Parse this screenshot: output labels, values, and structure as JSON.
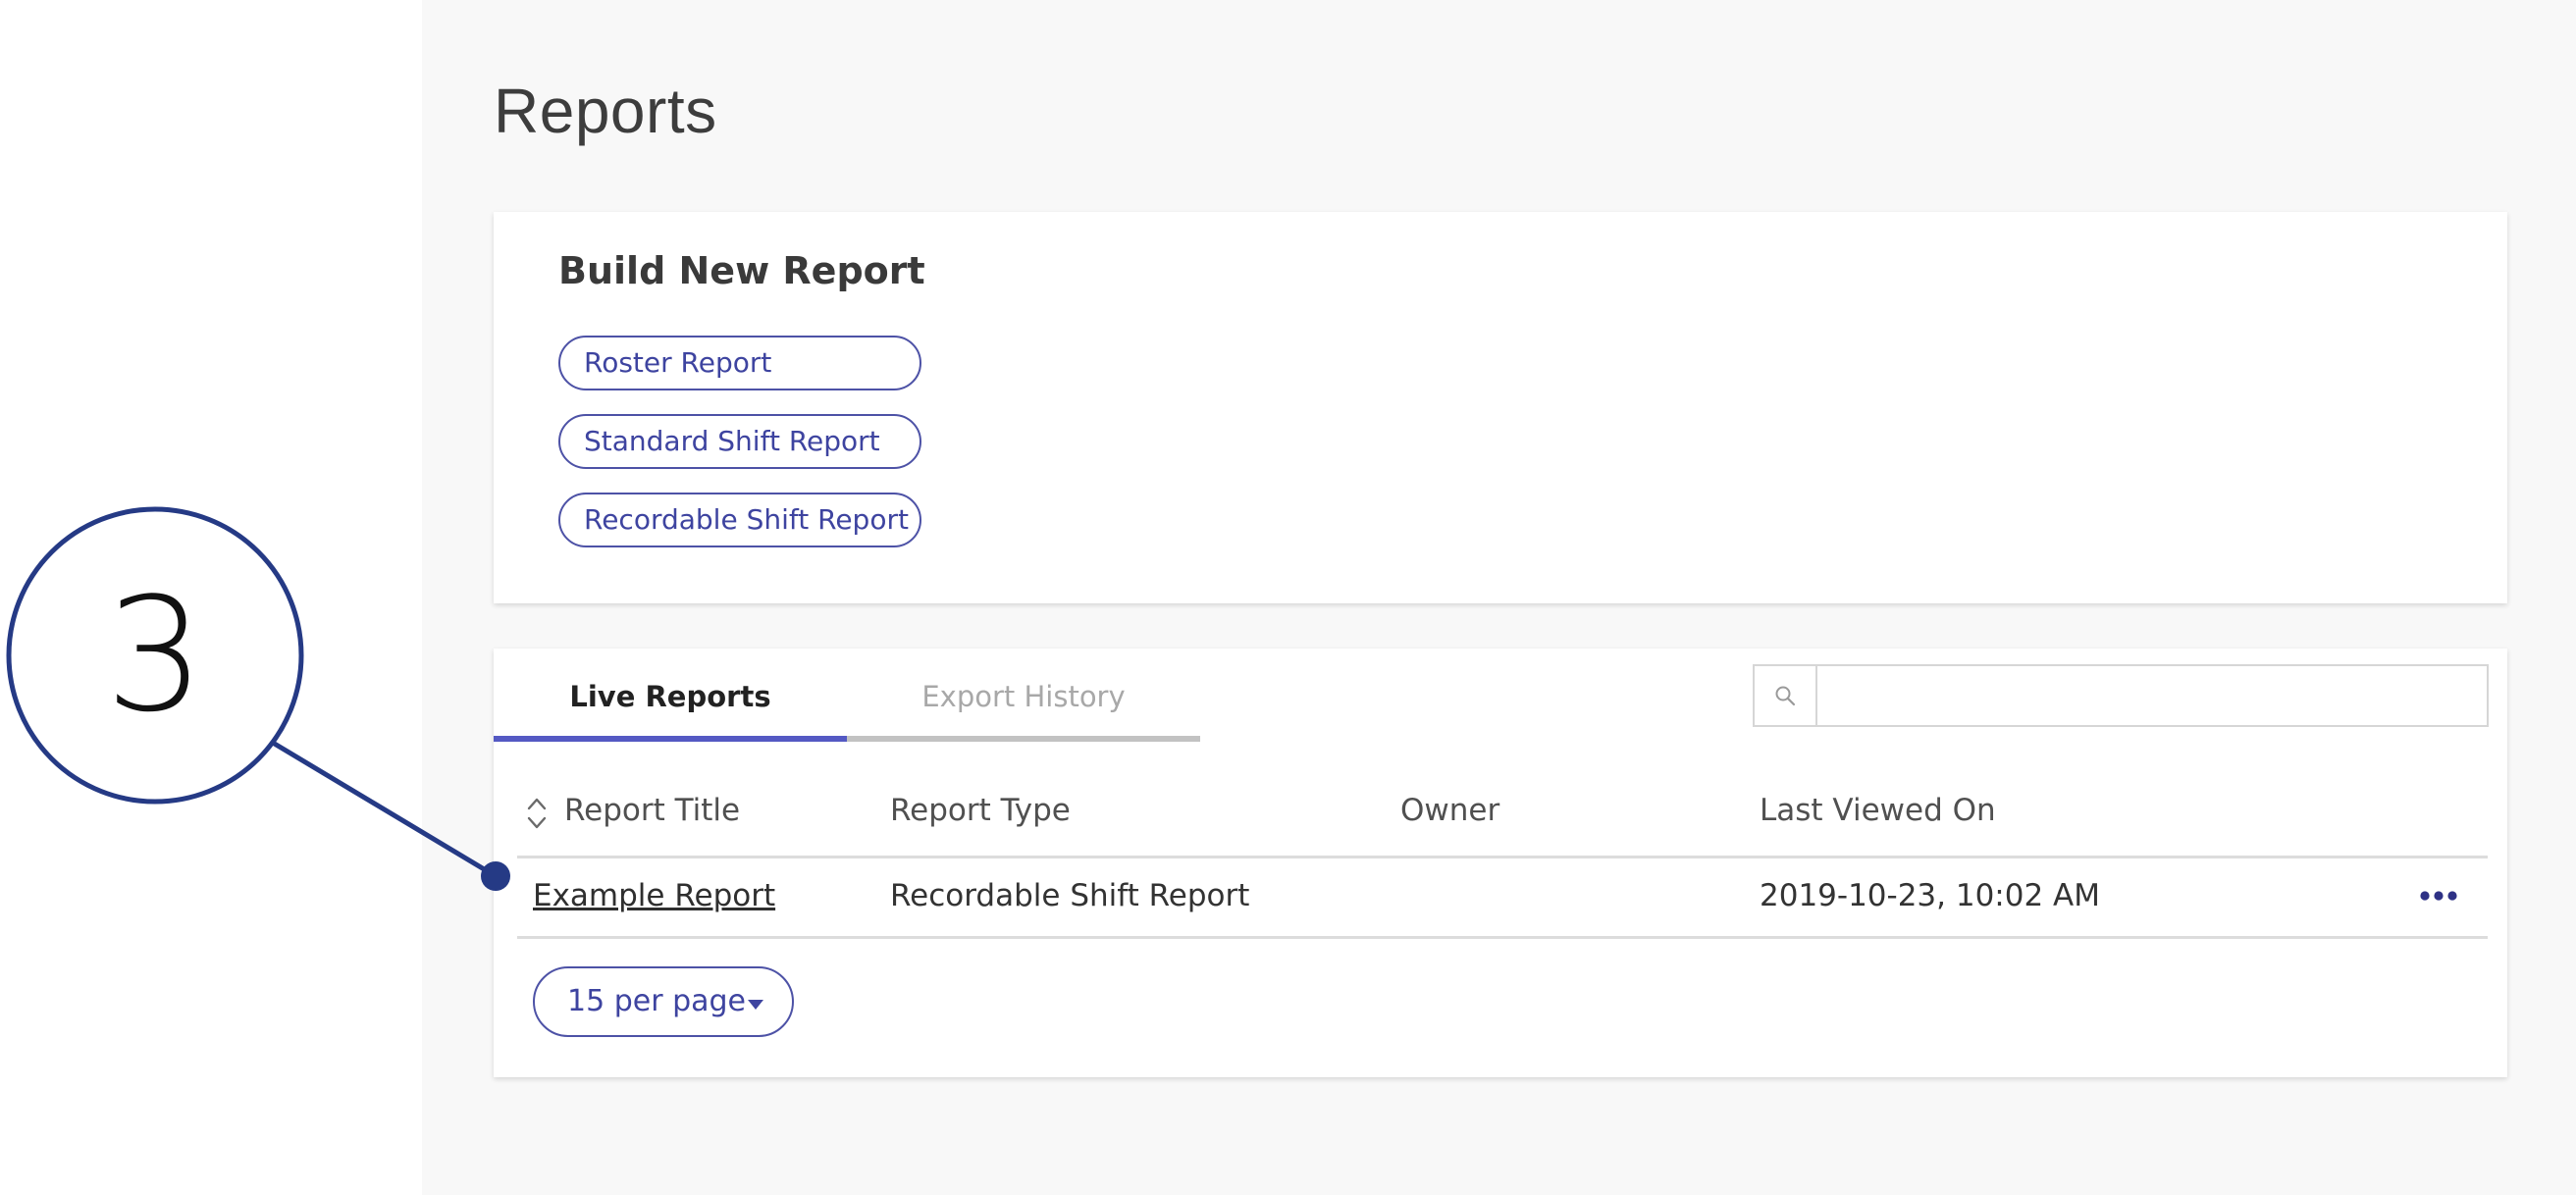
{
  "page": {
    "title": "Reports"
  },
  "build": {
    "title": "Build New Report",
    "buttons": [
      "Roster Report",
      "Standard Shift Report",
      "Recordable Shift Report"
    ]
  },
  "tabs": {
    "live": "Live Reports",
    "export": "Export History"
  },
  "search": {
    "placeholder": "",
    "value": ""
  },
  "table": {
    "headers": [
      "Report Title",
      "Report Type",
      "Owner",
      "Last Viewed On"
    ],
    "rows": [
      {
        "title": "Example Report",
        "type": "Recordable Shift Report",
        "owner": "",
        "last_viewed": "2019-10-23, 10:02 AM"
      }
    ]
  },
  "pagination": {
    "per_page": "15 per page"
  },
  "callout": {
    "number": "3"
  },
  "colors": {
    "accent": "#4d52a6",
    "tab_active": "#5459c3",
    "callout": "#253a85",
    "background": "#f8f8f8"
  },
  "icons": {
    "search": "search-icon",
    "sort": "sort-icon",
    "more": "more-horizontal-icon",
    "dropdown": "caret-down-icon"
  }
}
